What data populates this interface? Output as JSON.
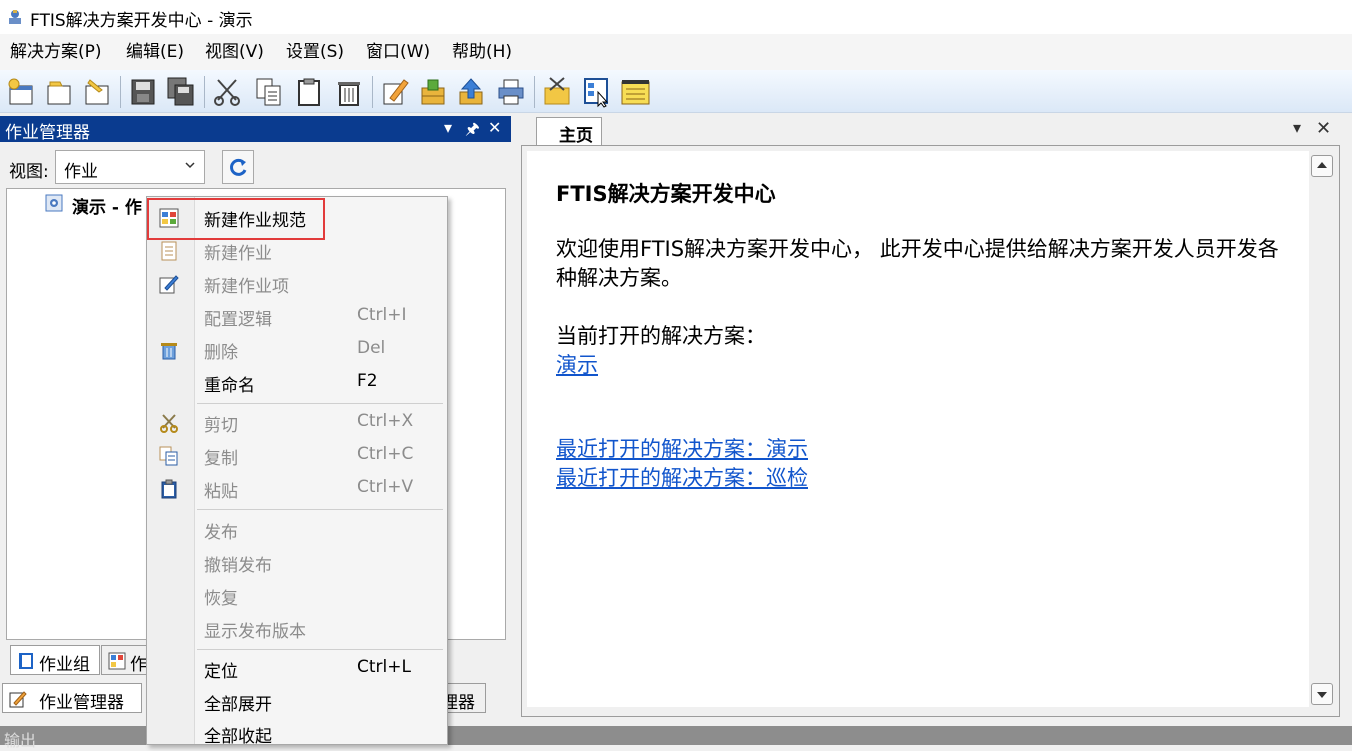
{
  "window": {
    "title": "FTIS解决方案开发中心 - 演示"
  },
  "menubar": {
    "items": [
      "解决方案(P)",
      "编辑(E)",
      "视图(V)",
      "设置(S)",
      "窗口(W)",
      "帮助(H)"
    ]
  },
  "toolbar": {
    "icons": [
      "new-solution-icon",
      "open-folder-icon",
      "edit-folder-icon",
      "save-icon",
      "save-all-icon",
      "cut-icon",
      "copy-icon",
      "paste-icon",
      "delete-icon",
      "edit-icon",
      "package-icon",
      "upload-icon",
      "print-icon",
      "folder-tool-icon",
      "document-select-icon",
      "notepad-icon"
    ]
  },
  "left_pane": {
    "title": "作业管理器",
    "view_label": "视图:",
    "view_value": "作业",
    "tree_node": "演示 - 作",
    "tabs": [
      "作业组",
      "作"
    ],
    "bottom_tabs": [
      "作业管理器",
      "理器"
    ]
  },
  "context_menu": {
    "items": [
      {
        "label": "新建作业规范",
        "key": "",
        "enabled": true,
        "icon": "job-spec-icon"
      },
      {
        "label": "新建作业",
        "key": "",
        "enabled": false,
        "icon": "job-icon"
      },
      {
        "label": "新建作业项",
        "key": "",
        "enabled": false,
        "icon": "edit-icon"
      },
      {
        "label": "配置逻辑",
        "key": "Ctrl+I",
        "enabled": false,
        "icon": ""
      },
      {
        "label": "删除",
        "key": "Del",
        "enabled": false,
        "icon": "trash-icon"
      },
      {
        "label": "重命名",
        "key": "F2",
        "enabled": true,
        "icon": ""
      },
      {
        "label": "剪切",
        "key": "Ctrl+X",
        "enabled": false,
        "icon": "scissors-icon"
      },
      {
        "label": "复制",
        "key": "Ctrl+C",
        "enabled": false,
        "icon": "copy-icon"
      },
      {
        "label": "粘贴",
        "key": "Ctrl+V",
        "enabled": false,
        "icon": "clipboard-icon"
      },
      {
        "label": "发布",
        "key": "",
        "enabled": false,
        "icon": ""
      },
      {
        "label": "撤销发布",
        "key": "",
        "enabled": false,
        "icon": ""
      },
      {
        "label": "恢复",
        "key": "",
        "enabled": false,
        "icon": ""
      },
      {
        "label": "显示发布版本",
        "key": "",
        "enabled": false,
        "icon": ""
      },
      {
        "label": "定位",
        "key": "Ctrl+L",
        "enabled": true,
        "icon": ""
      },
      {
        "label": "全部展开",
        "key": "",
        "enabled": true,
        "icon": ""
      },
      {
        "label": "全部收起",
        "key": "",
        "enabled": true,
        "icon": ""
      }
    ]
  },
  "right_pane": {
    "tab": "主页",
    "heading": "FTIS解决方案开发中心",
    "welcome": "欢迎使用FTIS解决方案开发中心， 此开发中心提供给解决方案开发人员开发各种解决方案。",
    "current_label": "当前打开的解决方案：",
    "current_link": "演示",
    "recent_links": [
      "最近打开的解决方案：演示",
      "最近打开的解决方案：巡检"
    ]
  },
  "statusbar": {
    "text": "输出"
  },
  "colors": {
    "pane_header": "#0a3b8f",
    "link": "#1155cc",
    "highlight": "#e23b3b",
    "disabled_text": "#8c8c8c"
  }
}
